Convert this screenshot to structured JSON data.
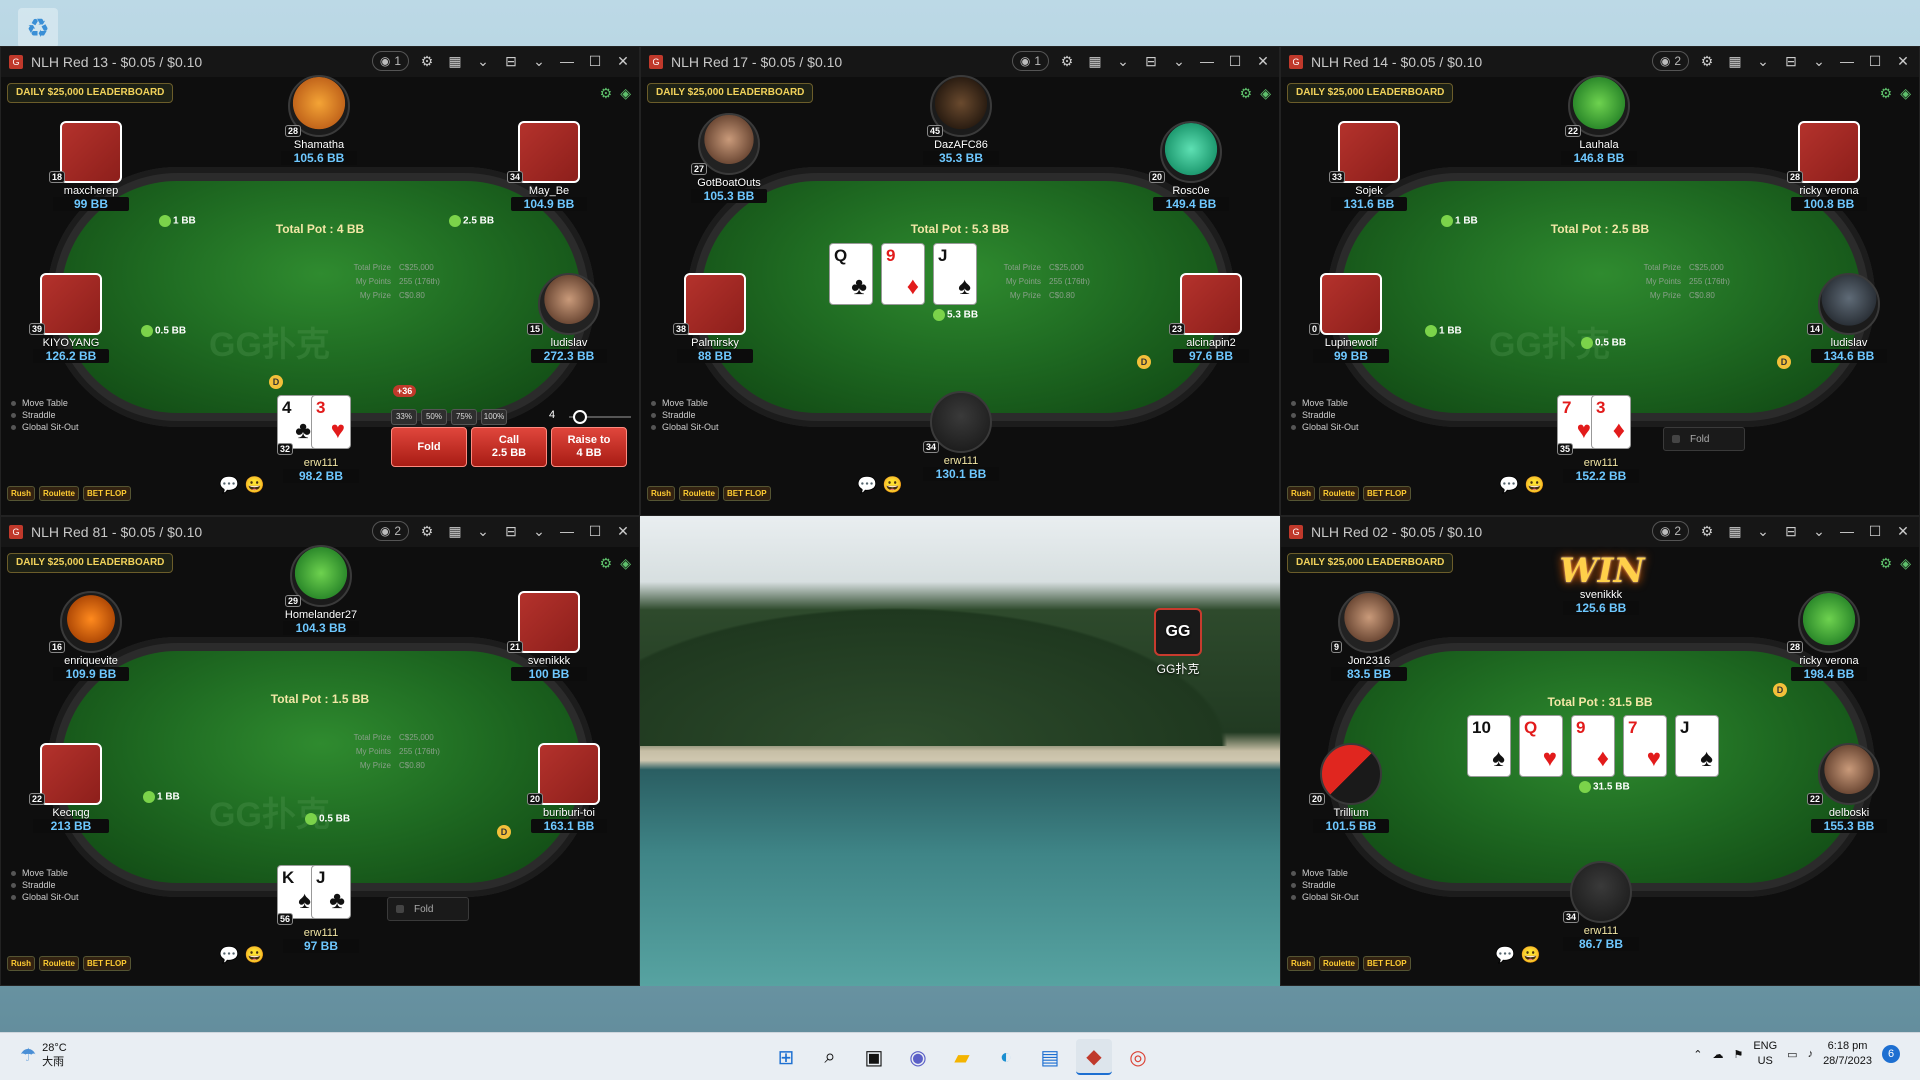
{
  "desktop": {
    "recycle_icon": "recycle-bin-icon",
    "gg_label": "GG扑克"
  },
  "windows": [
    {
      "title": "NLH Red 13 - $0.05 / $0.10",
      "observers": "1",
      "leaderboard": "DAILY $25,000 LEADERBOARD",
      "watermark": "GG扑克",
      "pot": "Total Pot : 4 BB",
      "prize": {
        "total_label": "Total Prize",
        "total": "C$25,000",
        "points_label": "My Points",
        "points": "255 (176th)",
        "myprize_label": "My Prize",
        "myprize": "C$0.80"
      },
      "players": [
        {
          "name": "Shamatha",
          "stack": "105.6 BB",
          "level": "28"
        },
        {
          "name": "maxcherep",
          "stack": "99 BB",
          "level": "18"
        },
        {
          "name": "May_Be",
          "stack": "104.9 BB",
          "level": "34"
        },
        {
          "name": "KIYOYANG",
          "stack": "126.2 BB",
          "level": "39"
        },
        {
          "name": "ludislav",
          "stack": "272.3 BB",
          "level": "15"
        },
        {
          "name": "erw111",
          "stack": "98.2 BB",
          "level": "32"
        }
      ],
      "bets": [
        "1 BB",
        "2.5 BB",
        "0.5 BB"
      ],
      "hero_cards": [
        {
          "rank": "4",
          "suit": "♣",
          "red": false
        },
        {
          "rank": "3",
          "suit": "♥",
          "red": true
        }
      ],
      "badge": "+36",
      "sizings": [
        "33%",
        "50%",
        "75%",
        "100%"
      ],
      "bet_value": "4",
      "actions": [
        {
          "label": "Fold",
          "sub": ""
        },
        {
          "label": "Call",
          "sub": "2.5 BB"
        },
        {
          "label": "Raise to",
          "sub": "4 BB"
        }
      ],
      "options": [
        "Move Table",
        "Straddle",
        "Global Sit-Out"
      ]
    },
    {
      "title": "NLH Red 17 - $0.05 / $0.10",
      "observers": "1",
      "leaderboard": "DAILY $25,000 LEADERBOARD",
      "pot": "Total Pot : 5.3 BB",
      "prize": {
        "total_label": "Total Prize",
        "total": "C$25,000",
        "points_label": "My Points",
        "points": "255 (176th)",
        "myprize_label": "My Prize",
        "myprize": "C$0.80"
      },
      "players": [
        {
          "name": "DazAFC86",
          "stack": "35.3 BB",
          "level": "45"
        },
        {
          "name": "GotBoatOuts",
          "stack": "105.3 BB",
          "level": "27"
        },
        {
          "name": "Rosc0e",
          "stack": "149.4 BB",
          "level": "20"
        },
        {
          "name": "Palmirsky",
          "stack": "88 BB",
          "level": "38"
        },
        {
          "name": "alcinapin2",
          "stack": "97.6 BB",
          "level": "23"
        },
        {
          "name": "erw111",
          "stack": "130.1 BB",
          "level": "34"
        }
      ],
      "board": [
        {
          "rank": "Q",
          "suit": "♣",
          "red": false
        },
        {
          "rank": "9",
          "suit": "♦",
          "red": true
        },
        {
          "rank": "J",
          "suit": "♠",
          "red": false
        }
      ],
      "center_bet": "5.3 BB",
      "options": [
        "Move Table",
        "Straddle",
        "Global Sit-Out"
      ]
    },
    {
      "title": "NLH Red 14 - $0.05 / $0.10",
      "observers": "2",
      "leaderboard": "DAILY $25,000 LEADERBOARD",
      "watermark": "GG扑克",
      "pot": "Total Pot : 2.5 BB",
      "prize": {
        "total_label": "Total Prize",
        "total": "C$25,000",
        "points_label": "My Points",
        "points": "255 (176th)",
        "myprize_label": "My Prize",
        "myprize": "C$0.80"
      },
      "players": [
        {
          "name": "Lauhala",
          "stack": "146.8 BB",
          "level": "22"
        },
        {
          "name": "Sojek",
          "stack": "131.6 BB",
          "level": "33"
        },
        {
          "name": "ricky verona",
          "stack": "100.8 BB",
          "level": "28"
        },
        {
          "name": "Lupinewolf",
          "stack": "99 BB",
          "level": "0"
        },
        {
          "name": "ludislav",
          "stack": "134.6 BB",
          "level": "14"
        },
        {
          "name": "erw111",
          "stack": "152.2 BB",
          "level": "35"
        }
      ],
      "bets": [
        "1 BB",
        "1 BB",
        "0.5 BB"
      ],
      "hero_cards": [
        {
          "rank": "7",
          "suit": "♥",
          "red": true
        },
        {
          "rank": "3",
          "suit": "♦",
          "red": true
        }
      ],
      "fold_label": "Fold",
      "options": [
        "Move Table",
        "Straddle",
        "Global Sit-Out"
      ]
    },
    {
      "title": "NLH Red 81 - $0.05 / $0.10",
      "observers": "2",
      "leaderboard": "DAILY $25,000 LEADERBOARD",
      "watermark": "GG扑克",
      "pot": "Total Pot : 1.5 BB",
      "prize": {
        "total_label": "Total Prize",
        "total": "C$25,000",
        "points_label": "My Points",
        "points": "255 (176th)",
        "myprize_label": "My Prize",
        "myprize": "C$0.80"
      },
      "players": [
        {
          "name": "Homelander27",
          "stack": "104.3 BB",
          "level": "29"
        },
        {
          "name": "enriquevite",
          "stack": "109.9 BB",
          "level": "16"
        },
        {
          "name": "svenikkk",
          "stack": "100 BB",
          "level": "21"
        },
        {
          "name": "Kecnqg",
          "stack": "213 BB",
          "level": "22"
        },
        {
          "name": "buriburi-toi",
          "stack": "163.1 BB",
          "level": "20"
        },
        {
          "name": "erw111",
          "stack": "97 BB",
          "level": "56"
        }
      ],
      "bets": [
        "1 BB",
        "0.5 BB"
      ],
      "hero_cards": [
        {
          "rank": "K",
          "suit": "♠",
          "red": false
        },
        {
          "rank": "J",
          "suit": "♣",
          "red": false
        }
      ],
      "fold_label": "Fold",
      "options": [
        "Move Table",
        "Straddle",
        "Global Sit-Out"
      ]
    },
    {
      "title": "NLH Red 02 - $0.05 / $0.10",
      "observers": "2",
      "leaderboard": "DAILY $25,000 LEADERBOARD",
      "pot": "Total Pot : 31.5 BB",
      "win_label": "WIN",
      "players": [
        {
          "name": "svenikkk",
          "stack": "125.6 BB",
          "level": ""
        },
        {
          "name": "Jon2316",
          "stack": "83.5 BB",
          "level": "9"
        },
        {
          "name": "ricky verona",
          "stack": "198.4 BB",
          "level": "28"
        },
        {
          "name": "Trillium",
          "stack": "101.5 BB",
          "level": "20"
        },
        {
          "name": "delboski",
          "stack": "155.3 BB",
          "level": "22"
        },
        {
          "name": "erw111",
          "stack": "86.7 BB",
          "level": "34"
        }
      ],
      "board": [
        {
          "rank": "10",
          "suit": "♠",
          "red": false
        },
        {
          "rank": "Q",
          "suit": "♥",
          "red": true
        },
        {
          "rank": "9",
          "suit": "♦",
          "red": true
        },
        {
          "rank": "7",
          "suit": "♥",
          "red": true
        },
        {
          "rank": "J",
          "suit": "♠",
          "red": false
        }
      ],
      "center_bet": "31.5 BB",
      "options": [
        "Move Table",
        "Straddle",
        "Global Sit-Out"
      ]
    }
  ],
  "promos": [
    "Rush",
    "Roulette",
    "BET FLOP"
  ],
  "taskbar": {
    "temp": "28°C",
    "weather": "大雨",
    "lang1": "ENG",
    "lang2": "US",
    "time": "6:18 pm",
    "date": "28/7/2023",
    "notif": "6"
  }
}
